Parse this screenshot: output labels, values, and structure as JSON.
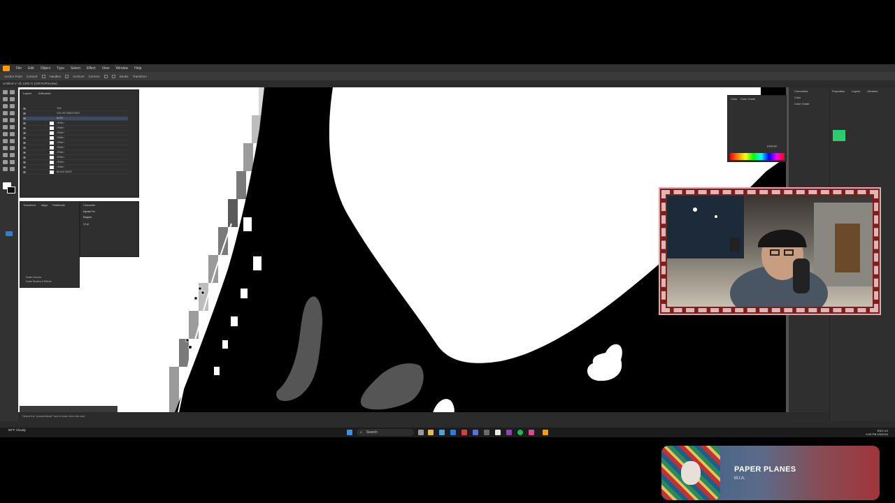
{
  "app": {
    "menu": [
      "File",
      "Edit",
      "Object",
      "Type",
      "Select",
      "Effect",
      "View",
      "Window",
      "Help"
    ],
    "controls": [
      "Anchor Point",
      "Convert",
      "Handles",
      "Anchors",
      "Corners",
      "Stroke",
      "Transform"
    ],
    "document_tab": "Untitled-1* @ 1200 % (CMYK/Preview)",
    "status_hint": "Select the \"pucker/bloat\" tool to learn from the tool",
    "brand_color": "#ff9a00"
  },
  "layers": {
    "tabs": [
      "Layers",
      "Artboards"
    ],
    "rows": [
      "Text",
      "COLOR SWATCHES",
      "BASE",
      "<Path>",
      "<Path>",
      "<Path>",
      "<Path>",
      "<Path>",
      "<Path>",
      "<Path>",
      "<Path>",
      "<Path>",
      "<Path>",
      "BLACK BASE"
    ]
  },
  "properties": {
    "tabs": [
      "Transform",
      "Align",
      "Pathfinder"
    ],
    "checks": [
      "Scale Corners",
      "Scale Strokes & Effects"
    ]
  },
  "character": {
    "title": "Character",
    "font": "Myriad Pro",
    "style": "Regular",
    "size": "12 pt"
  },
  "color_panel": {
    "tabs": [
      "Color",
      "Color Guide"
    ],
    "swatch_hex": "FFFFFF",
    "accent_swatch": "#2ecc71"
  },
  "right_dock": {
    "tabs": [
      "Comments",
      "Color",
      "Color Guide"
    ],
    "items": [
      "Properties",
      "Layers",
      "Libraries"
    ]
  },
  "taskbar": {
    "weather": "59°F Cloudy",
    "search_placeholder": "Search",
    "tray_lines": [
      "ENG US",
      "6:05 PM 4/5/2024"
    ]
  },
  "music": {
    "title": "PAPER PLANES",
    "artist": "M.I.A."
  }
}
